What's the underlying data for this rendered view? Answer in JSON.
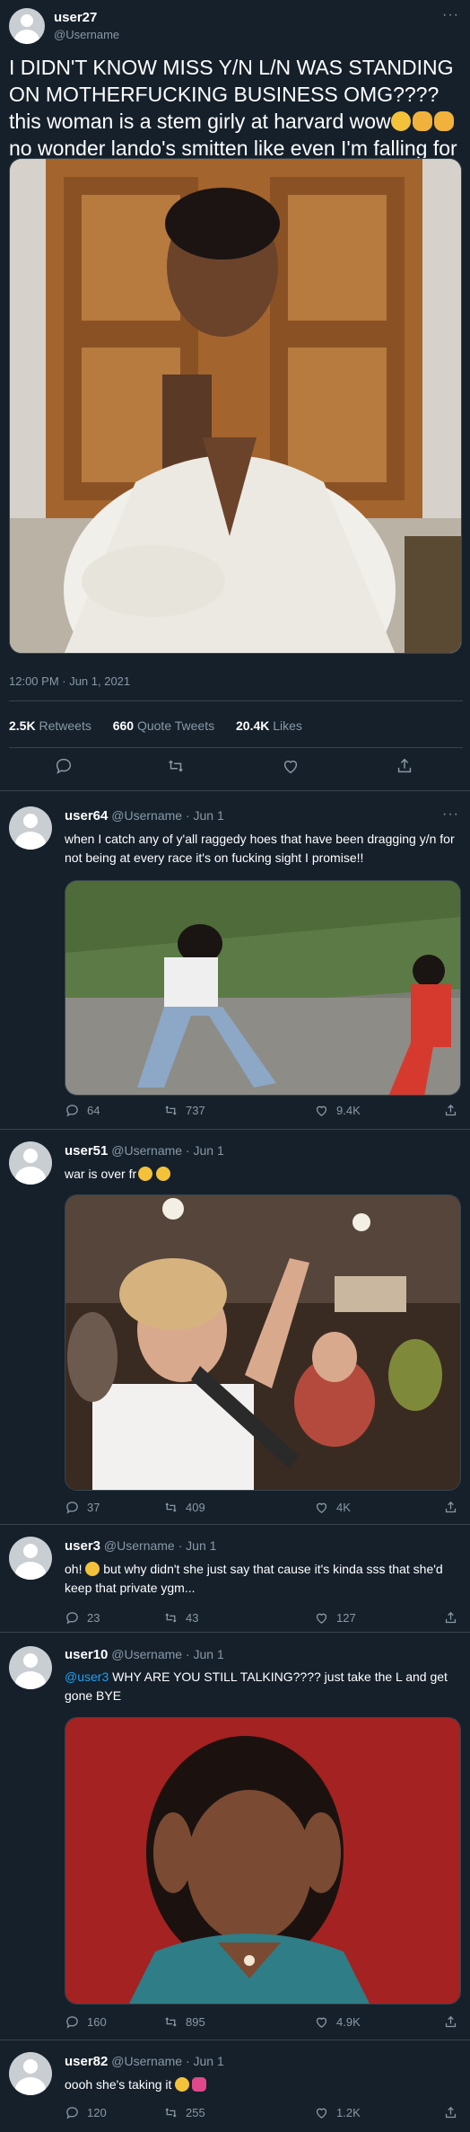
{
  "main_tweet": {
    "user": "user27",
    "handle": "@Username",
    "text_part1": "I DIDN'T KNOW MISS Y/N L/N WAS STANDING ON MOTHERFUCKING BUSINESS OMG???? this woman is a stem girly at harvard wow",
    "text_part2": " no wonder lando's smitten like even I'm falling for her harrrd",
    "timestamp": "12:00 PM · Jun 1, 2021",
    "retweets_count": "2.5K",
    "retweets_label": "Retweets",
    "quote_count": "660",
    "quote_label": "Quote Tweets",
    "likes_count": "20.4K",
    "likes_label": "Likes"
  },
  "replies": [
    {
      "user": "user64",
      "handle": "@Username",
      "date": "· Jun 1",
      "text": "when I catch any of y'all raggedy hoes that have been dragging y/n for not being at every race it's on fucking sight I promise!!",
      "replies": "64",
      "retweets": "737",
      "likes": "9.4K"
    },
    {
      "user": "user51",
      "handle": "@Username",
      "date": "· Jun 1",
      "text": "war is over fr",
      "replies": "37",
      "retweets": "409",
      "likes": "4K"
    },
    {
      "user": "user3",
      "handle": "@Username",
      "date": "· Jun 1",
      "text_before": "oh!",
      "text_after": " but why didn't she just say that cause it's kinda sss that she'd keep that private ygm...",
      "replies": "23",
      "retweets": "43",
      "likes": "127"
    },
    {
      "user": "user10",
      "handle": "@Username",
      "date": "· Jun 1",
      "mention": "@user3",
      "text": " WHY ARE YOU STILL TALKING???? just take the L and get gone BYE",
      "replies": "160",
      "retweets": "895",
      "likes": "4.9K"
    },
    {
      "user": "user82",
      "handle": "@Username",
      "date": "· Jun 1",
      "text": "oooh she's taking it",
      "replies": "120",
      "retweets": "255",
      "likes": "1.2K"
    }
  ],
  "icons": {
    "reply": "reply-icon",
    "retweet": "retweet-icon",
    "like": "heart-icon",
    "share": "share-icon",
    "more": "more-icon"
  },
  "colors": {
    "background": "#15202b",
    "text": "#ffffff",
    "muted": "#8899a6",
    "divider": "#38444d",
    "mention": "#1da1f2"
  }
}
